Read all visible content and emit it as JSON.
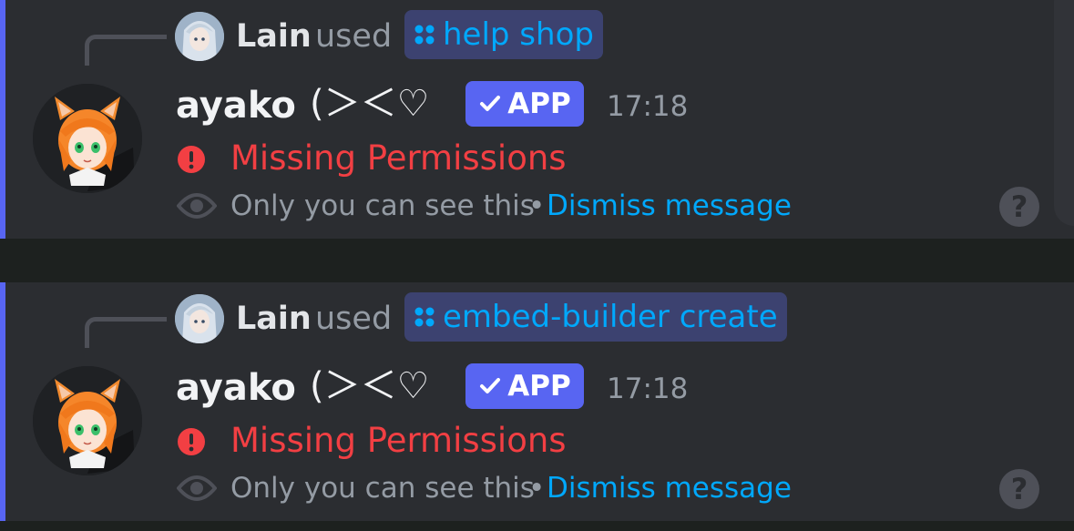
{
  "messages": [
    {
      "reply": {
        "user": "Lain",
        "verb": "used",
        "command": "help shop"
      },
      "author": {
        "name": "ayako",
        "decoration": "(＞＜♡",
        "badge": "APP"
      },
      "timestamp": "17:18",
      "error": "Missing Permissions",
      "ephemeral": {
        "notice": "Only you can see this",
        "separator": "•",
        "dismiss_label": "Dismiss message"
      },
      "help_icon": "?"
    },
    {
      "reply": {
        "user": "Lain",
        "verb": "used",
        "command": "embed-builder create"
      },
      "author": {
        "name": "ayako",
        "decoration": "(＞＜♡",
        "badge": "APP"
      },
      "timestamp": "17:18",
      "error": "Missing Permissions",
      "ephemeral": {
        "notice": "Only you can see this",
        "separator": "•",
        "dismiss_label": "Dismiss message"
      },
      "help_icon": "?"
    }
  ],
  "icons": {
    "command": "slash-command-icon",
    "badge": "checkmark-icon",
    "error": "error-icon",
    "ephemeral": "eye-icon",
    "help": "help-icon"
  },
  "colors": {
    "accent": "#5865f2",
    "background": "#2b2d31",
    "separator": "#1d211f",
    "error": "#f23f43",
    "link": "#00a8fc",
    "muted": "#949ba4",
    "command_pill": "#3c4270"
  }
}
